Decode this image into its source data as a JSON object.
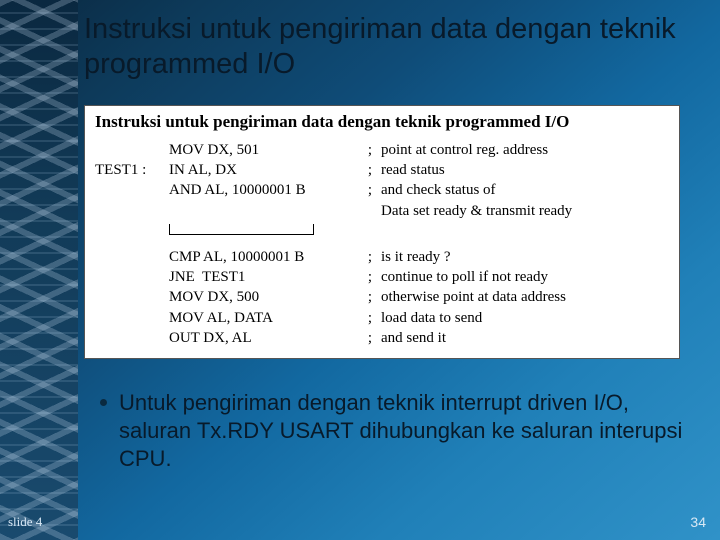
{
  "title": "Instruksi untuk pengiriman data dengan teknik programmed I/O",
  "figure": {
    "heading": "Instruksi untuk pengiriman data dengan teknik programmed I/O",
    "rows1": [
      {
        "label": "",
        "instr": "MOV DX, 501",
        "sep": ";",
        "comment": "point at control reg. address"
      },
      {
        "label": "TEST1 :",
        "instr": "IN AL, DX",
        "sep": ";",
        "comment": "read status"
      },
      {
        "label": "",
        "instr": "AND AL, 10000001 B",
        "sep": ";",
        "comment": "and check status of"
      },
      {
        "label": "",
        "instr": "",
        "sep": "",
        "comment": "Data set ready & transmit ready"
      }
    ],
    "rows2": [
      {
        "label": "",
        "instr": "CMP AL, 10000001 B",
        "sep": ";",
        "comment": "is it ready ?"
      },
      {
        "label": "",
        "instr": "JNE  TEST1",
        "sep": ";",
        "comment": "continue to poll if not ready"
      },
      {
        "label": "",
        "instr": "MOV DX, 500",
        "sep": ";",
        "comment": "otherwise point at data address"
      },
      {
        "label": "",
        "instr": "MOV AL, DATA",
        "sep": ";",
        "comment": "load data to send"
      },
      {
        "label": "",
        "instr": "OUT DX, AL",
        "sep": ";",
        "comment": "and send it"
      }
    ]
  },
  "bullet": "Untuk pengiriman dengan teknik interrupt driven I/O, saluran Tx.RDY USART dihubungkan ke saluran interupsi CPU.",
  "footer": {
    "slide_label": "slide 4",
    "page_number": "34"
  }
}
